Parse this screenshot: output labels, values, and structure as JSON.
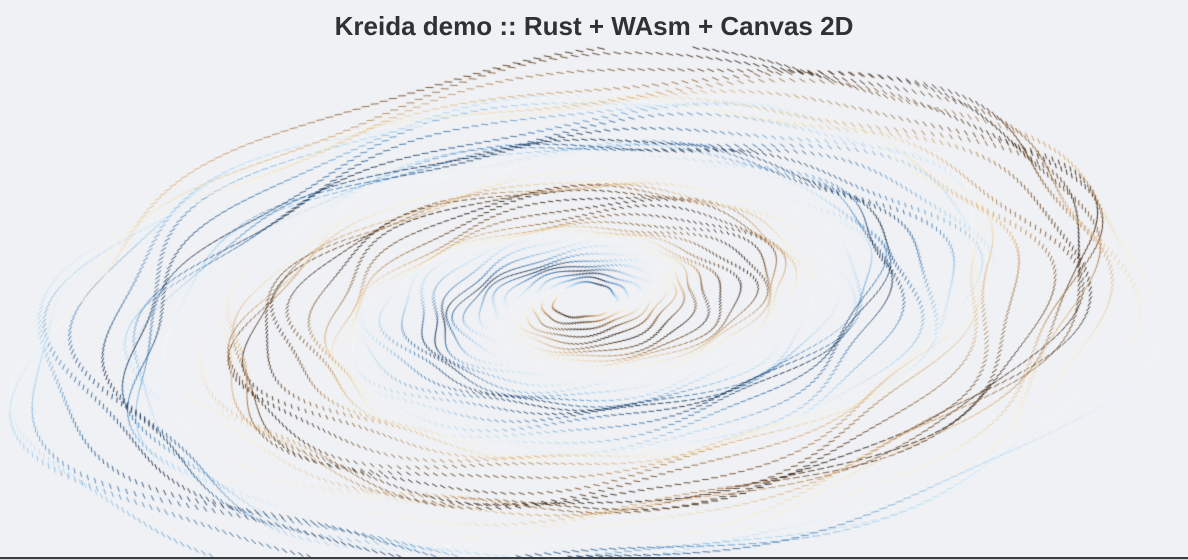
{
  "header": {
    "title": "Kreida demo :: Rust + WAsm + Canvas 2D"
  },
  "artwork": {
    "description_kind": "spiral-flow-field",
    "palette": {
      "background": "#eff1f4",
      "navy": "#0b1f3d",
      "blue": "#2f6eb0",
      "light_blue": "#9fd0f4",
      "pale": "#f6fbff",
      "cream": "#fbeec8",
      "tan": "#d7a266",
      "brown": "#6a3e18",
      "dark": "#170c06"
    }
  }
}
